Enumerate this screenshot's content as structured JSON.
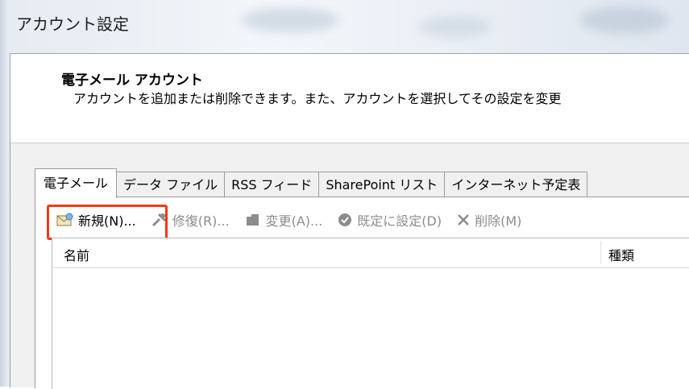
{
  "window": {
    "title": "アカウント設定"
  },
  "header": {
    "title": "電子メール アカウント",
    "description": "アカウントを追加または削除できます。また、アカウントを選択してその設定を変更"
  },
  "tabs": [
    {
      "label": "電子メール",
      "active": true
    },
    {
      "label": "データ ファイル",
      "active": false
    },
    {
      "label": "RSS フィード",
      "active": false
    },
    {
      "label": "SharePoint リスト",
      "active": false
    },
    {
      "label": "インターネット予定表",
      "active": false
    }
  ],
  "toolbar": {
    "new_label": "新規(N)...",
    "repair_label": "修復(R)...",
    "change_label": "変更(A)...",
    "default_label": "既定に設定(D)",
    "delete_label": "削除(M)"
  },
  "list": {
    "columns": {
      "name": "名前",
      "type": "種類"
    }
  },
  "colors": {
    "highlight": "#ef3b16",
    "disabled_text": "#8c8c8c",
    "panel_bg": "#f0f0f0"
  },
  "icons": {
    "new": "mail-envelope-icon",
    "repair": "tools-icon",
    "change": "folder-icon",
    "default": "check-circle-icon",
    "delete": "x-icon"
  }
}
